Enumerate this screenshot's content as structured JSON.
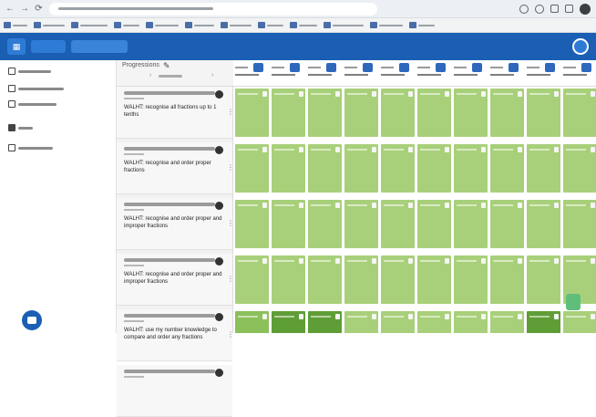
{
  "browser": {
    "nav": {
      "back": "←",
      "forward": "→",
      "reload": "⟳"
    },
    "bookmark_count": 12
  },
  "app": {
    "logo_icon": "apps-grid-icon",
    "user_avatar": "user-avatar"
  },
  "sidebar": {
    "items": [
      {
        "icon": "menu-icon",
        "kind": "icon-only"
      },
      {
        "icon": "list-icon"
      },
      {
        "icon": "calendar-event-icon"
      },
      {
        "icon": "folder-icon"
      },
      {
        "icon": "calendar-icon"
      }
    ],
    "chat_icon": "chat-bubble-icon"
  },
  "progression": {
    "title": "Progressions",
    "edit_icon": "pencil-icon",
    "pager_prev": "‹",
    "pager_next": "›",
    "rows": [
      {
        "title": "WALHT: recognise all fractions up to 1 tenths",
        "menu": "⋮"
      },
      {
        "title": "WALHT: recognise and order proper fractions",
        "menu": "⋮"
      },
      {
        "title": "WALHT: recognise and order proper and improper fractions",
        "menu": "⋮"
      },
      {
        "title": "WALHT: recognise and order proper and improper fractions",
        "menu": "⋮"
      },
      {
        "title": "WALHT: use my number knowledge to compare and order any fractions",
        "menu": "⋮"
      },
      {
        "title": "",
        "menu": ""
      }
    ]
  },
  "students": [
    {
      "badge_color": "#2f67bd"
    },
    {
      "badge_color": "#2f67bd"
    },
    {
      "badge_color": "#2f67bd"
    },
    {
      "badge_color": "#2f67bd"
    },
    {
      "badge_color": "#2f67bd"
    },
    {
      "badge_color": "#2f67bd"
    },
    {
      "badge_color": "#2f67bd"
    },
    {
      "badge_color": "#2f67bd"
    },
    {
      "badge_color": "#2f67bd"
    },
    {
      "badge_color": "#2f67bd"
    }
  ],
  "colors": {
    "app_bar": "#1a5fb4",
    "light_green": "#a8d07a",
    "mid_green": "#8bc05a",
    "dark_green": "#5f9e36"
  },
  "grid_levels": [
    [
      "light",
      "light",
      "light",
      "light",
      "light",
      "light",
      "light",
      "light",
      "light",
      "light"
    ],
    [
      "light",
      "light",
      "light",
      "light",
      "light",
      "light",
      "light",
      "light",
      "light",
      "light"
    ],
    [
      "light",
      "light",
      "light",
      "light",
      "light",
      "light",
      "light",
      "light",
      "light",
      "light"
    ],
    [
      "light",
      "light",
      "light",
      "light",
      "light",
      "light",
      "light",
      "light",
      "light",
      "light"
    ],
    [
      "mid",
      "dark",
      "dark",
      "light",
      "light",
      "light",
      "light",
      "light",
      "dark",
      "light"
    ],
    [
      "mid",
      "dark",
      "mid",
      "dark",
      "light",
      "light",
      "light",
      "dark",
      "dark",
      "light"
    ]
  ]
}
